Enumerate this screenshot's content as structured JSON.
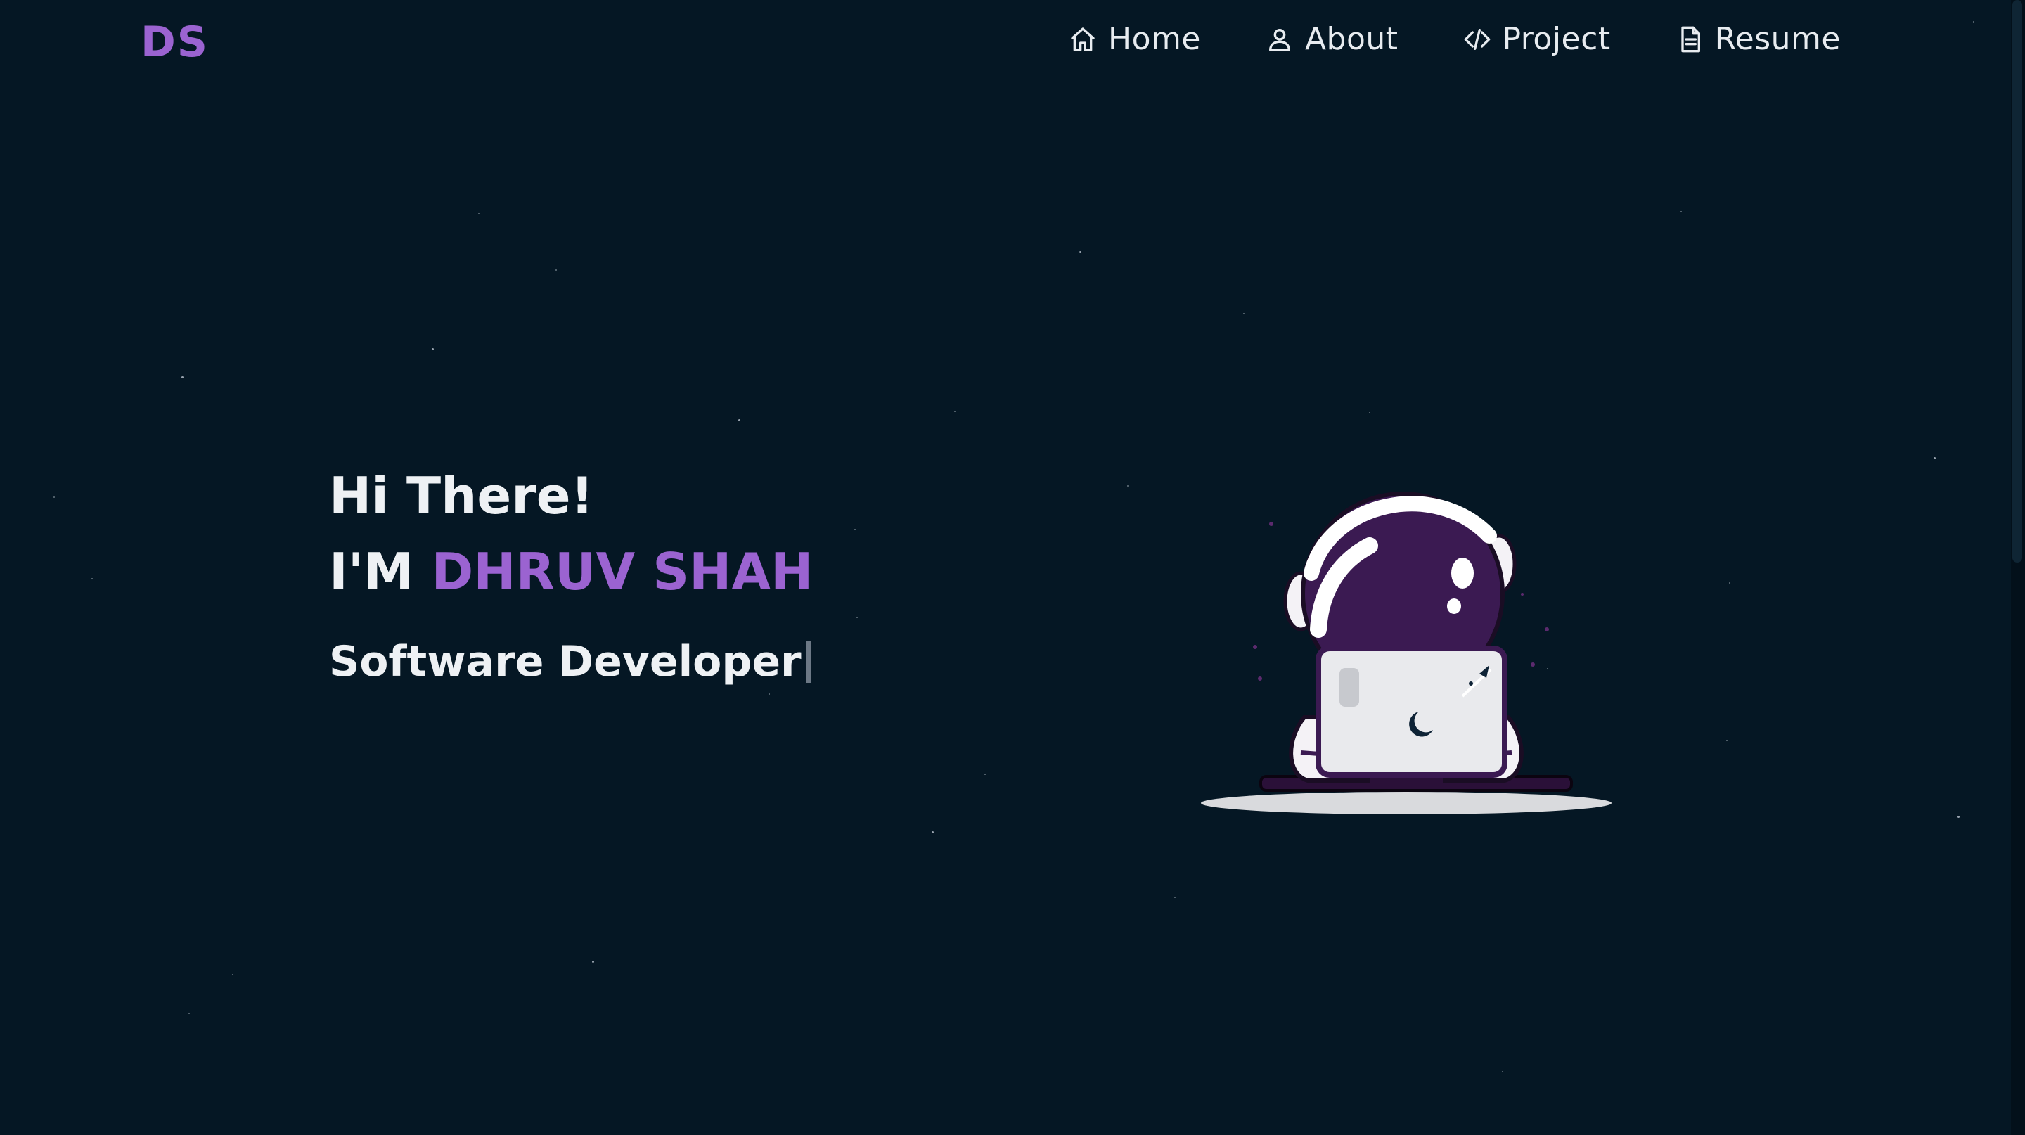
{
  "brand": {
    "logo_text": "DS",
    "accent_color": "#9b63d1",
    "background_color": "#051724"
  },
  "nav": {
    "items": [
      {
        "label": "Home",
        "icon": "home-icon"
      },
      {
        "label": "About",
        "icon": "user-icon"
      },
      {
        "label": "Project",
        "icon": "code-icon"
      },
      {
        "label": "Resume",
        "icon": "document-icon"
      }
    ]
  },
  "hero": {
    "greeting": "Hi There!",
    "name_prefix": "I'M ",
    "name": "DHRUV SHAH",
    "role": "Software Developer"
  },
  "illustration": {
    "icon": "astronaut-laptop-illustration"
  }
}
